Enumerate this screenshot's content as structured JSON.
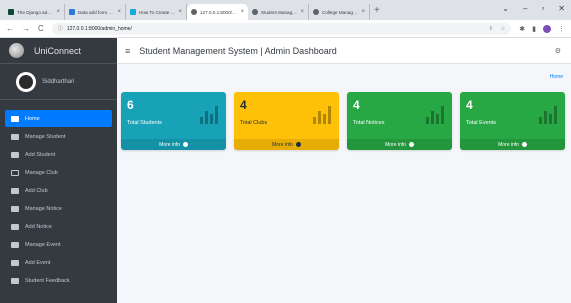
{
  "browser": {
    "tabs": [
      {
        "title": "The Django admin ma",
        "favicon_color": "#0c4b33",
        "active": false
      },
      {
        "title": "Data add form class h",
        "favicon_color": "#2b7bd6",
        "active": false
      },
      {
        "title": "How To Create a Hi",
        "favicon_color": "#14a8dd",
        "active": false
      },
      {
        "title": "127.0.0.1:8000/admi",
        "favicon_color": "#5f6368",
        "active": true
      },
      {
        "title": "Student Manageme",
        "favicon_color": "#5f6368",
        "active": false
      },
      {
        "title": "College Managemen",
        "favicon_color": "#5f6368",
        "active": false
      }
    ],
    "url": "127.0.0.1:8000/admin_home/"
  },
  "sidebar": {
    "brand": "UniConnect",
    "user_name": "Siddharthari",
    "items": [
      {
        "label": "Home",
        "active": true
      },
      {
        "label": "Manage Student",
        "active": false
      },
      {
        "label": "Add Student",
        "active": false
      },
      {
        "label": "Manage Club",
        "active": false
      },
      {
        "label": "Add Club",
        "active": false
      },
      {
        "label": "Manage Notice",
        "active": false
      },
      {
        "label": "Add Notice",
        "active": false
      },
      {
        "label": "Manage Event",
        "active": false
      },
      {
        "label": "Add Event",
        "active": false
      },
      {
        "label": "Student Feedback",
        "active": false
      }
    ]
  },
  "header": {
    "title": "Student Management System | Admin Dashboard"
  },
  "breadcrumb": "Home",
  "cards": [
    {
      "value": "6",
      "label": "Total Students",
      "footer": "More info",
      "color": "#17a2b8"
    },
    {
      "value": "4",
      "label": "Total Clubs",
      "footer": "More info",
      "color": "#ffc107"
    },
    {
      "value": "4",
      "label": "Total Notices",
      "footer": "More info",
      "color": "#28a745"
    },
    {
      "value": "4",
      "label": "Total Events",
      "footer": "More info",
      "color": "#28a745"
    }
  ]
}
